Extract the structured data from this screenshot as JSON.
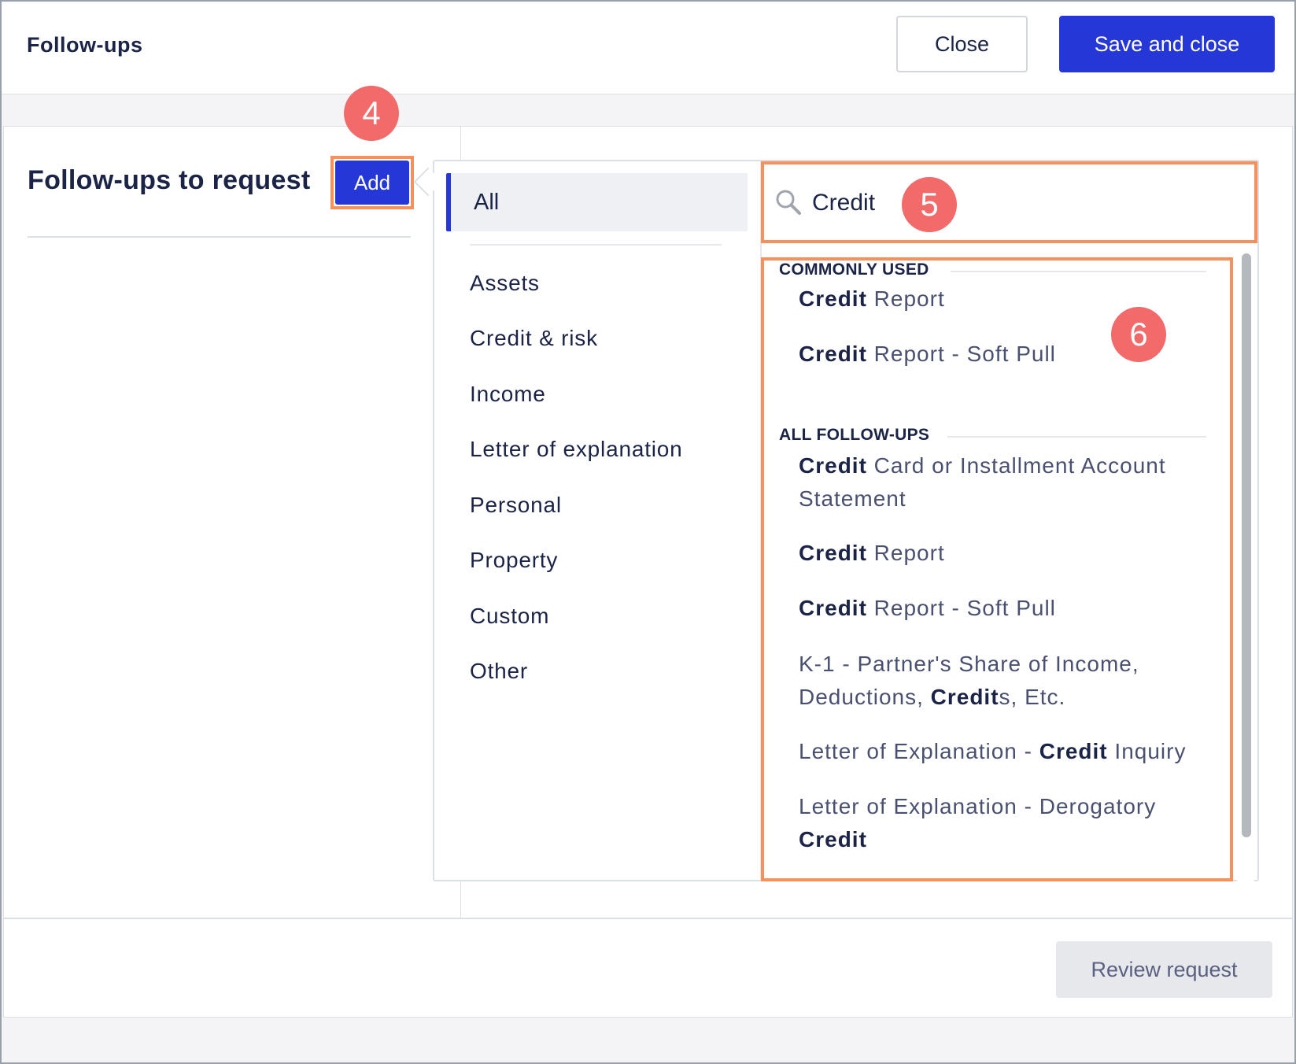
{
  "header": {
    "title": "Follow-ups",
    "close_label": "Close",
    "save_label": "Save and close"
  },
  "section": {
    "title": "Follow-ups to request",
    "add_label": "Add"
  },
  "annotations": {
    "step4": "4",
    "step5": "5",
    "step6": "6"
  },
  "categories": {
    "all": "All",
    "items": [
      "Assets",
      "Credit & risk",
      "Income",
      "Letter of explanation",
      "Personal",
      "Property",
      "Custom",
      "Other"
    ]
  },
  "search": {
    "value": "Credit",
    "icon": "search-icon"
  },
  "results": {
    "commonly_used_header": "COMMONLY USED",
    "all_header": "ALL FOLLOW-UPS",
    "commonly_used": [
      {
        "parts": [
          {
            "b": "Credit"
          },
          {
            "t": " Report"
          }
        ]
      },
      {
        "parts": [
          {
            "b": "Credit"
          },
          {
            "t": " Report - Soft Pull"
          }
        ]
      }
    ],
    "all": [
      {
        "parts": [
          {
            "b": "Credit"
          },
          {
            "t": " Card or Installment Account Statement"
          }
        ]
      },
      {
        "parts": [
          {
            "b": "Credit"
          },
          {
            "t": " Report"
          }
        ]
      },
      {
        "parts": [
          {
            "b": "Credit"
          },
          {
            "t": " Report - Soft Pull"
          }
        ]
      },
      {
        "parts": [
          {
            "t": "K-1 - Partner's Share of Income, Deductions, "
          },
          {
            "b": "Credit"
          },
          {
            "t": "s, Etc."
          }
        ]
      },
      {
        "parts": [
          {
            "t": "Letter of Explanation - "
          },
          {
            "b": "Credit"
          },
          {
            "t": " Inquiry"
          }
        ]
      },
      {
        "parts": [
          {
            "t": "Letter of Explanation - Derogatory "
          },
          {
            "b": "Credit"
          }
        ]
      }
    ]
  },
  "footer": {
    "review_label": "Review request"
  },
  "colors": {
    "primary": "#2637d8",
    "highlight": "#f4915c",
    "badge": "#f26a6a",
    "text": "#1b2446"
  }
}
